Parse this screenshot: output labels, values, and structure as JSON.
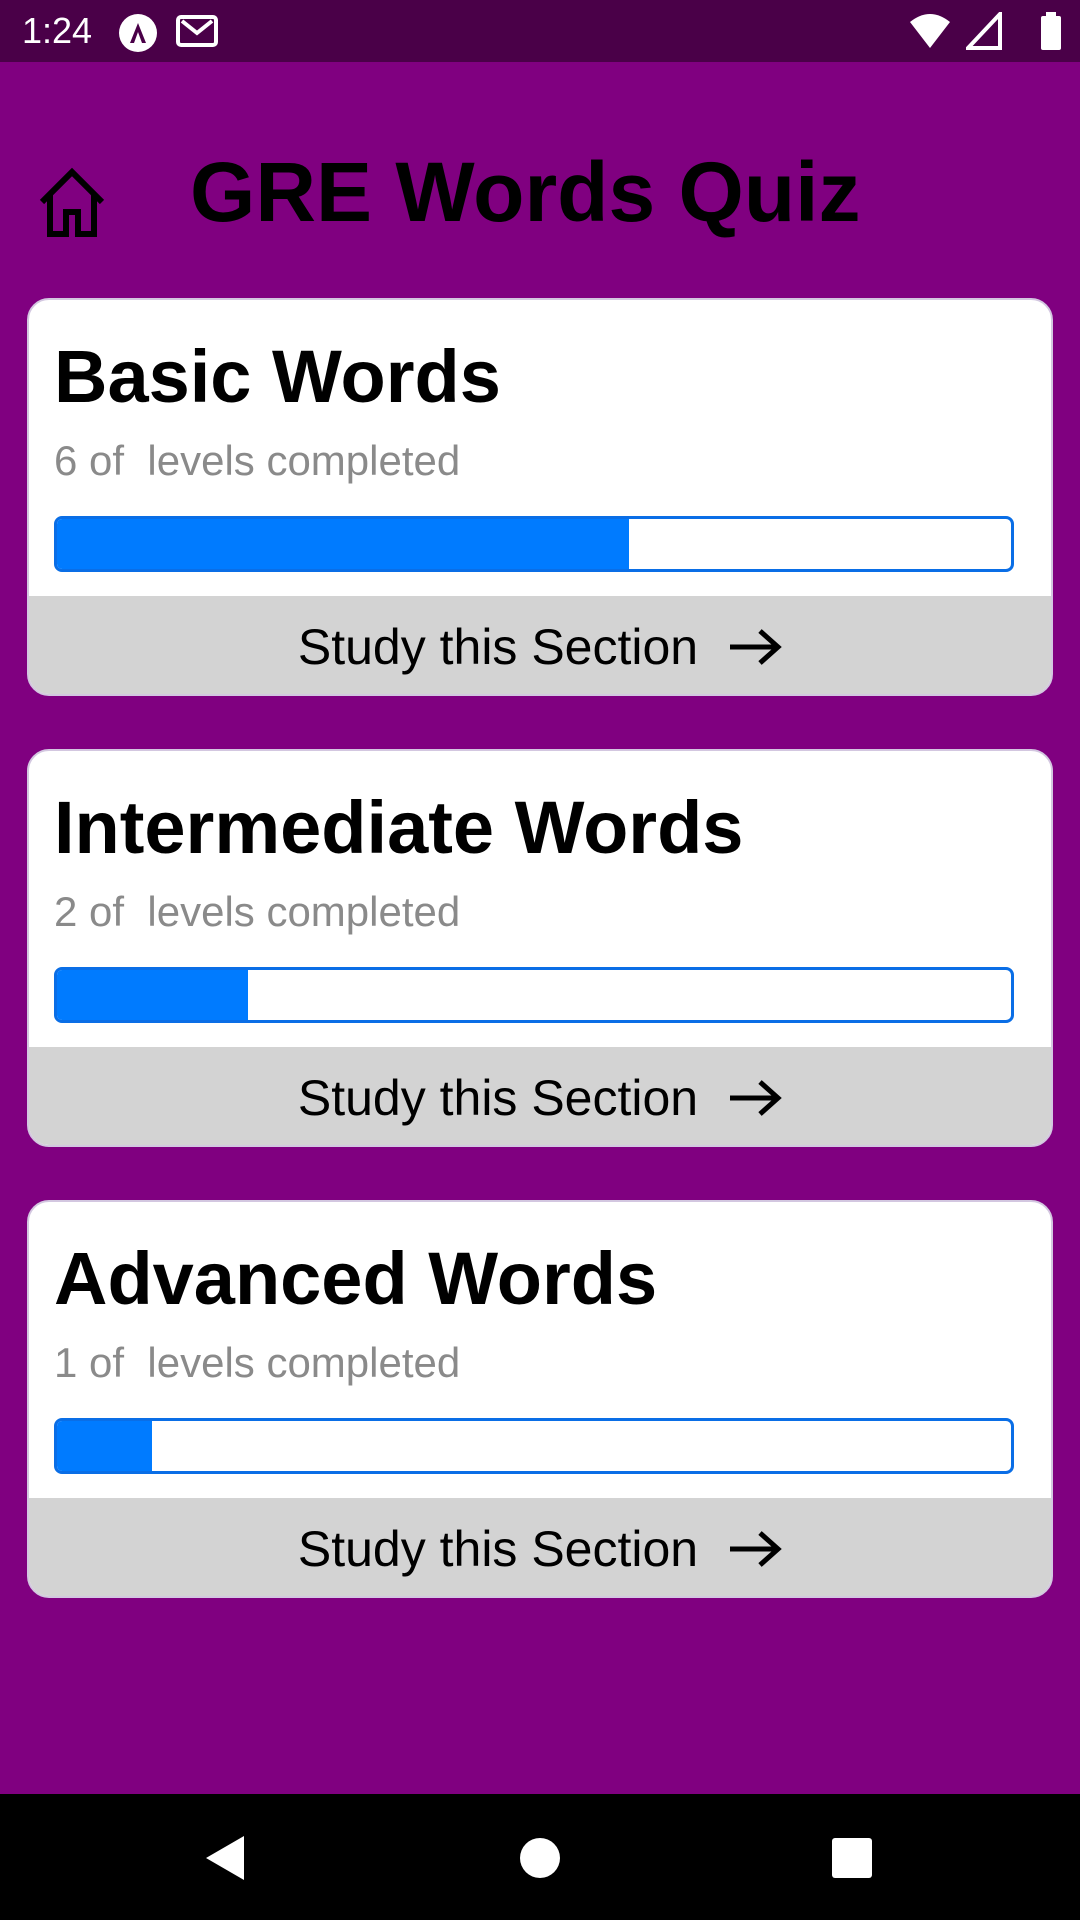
{
  "status_bar": {
    "time": "1:24",
    "icons": [
      "android-auto-icon",
      "gmail-icon",
      "wifi-icon",
      "signal-icon",
      "battery-icon"
    ]
  },
  "header": {
    "title": "GRE Words Quiz",
    "home_icon": "home-icon"
  },
  "sections": [
    {
      "title": "Basic Words",
      "progress_text": "6 of  levels completed",
      "progress_fraction": 0.6,
      "button_label": "Study this Section"
    },
    {
      "title": "Intermediate Words",
      "progress_text": "2 of  levels completed",
      "progress_fraction": 0.2,
      "button_label": "Study this Section"
    },
    {
      "title": "Advanced Words",
      "progress_text": "1 of  levels completed",
      "progress_fraction": 0.1,
      "button_label": "Study this Section"
    }
  ],
  "colors": {
    "background": "#800080",
    "status_bar": "#4a0048",
    "progress_fill": "#007bff",
    "progress_border": "#0a6ee6",
    "button_bg": "#d3d3d3"
  },
  "nav_bar": {
    "icons": [
      "back-icon",
      "home-circle-icon",
      "recents-icon"
    ]
  }
}
